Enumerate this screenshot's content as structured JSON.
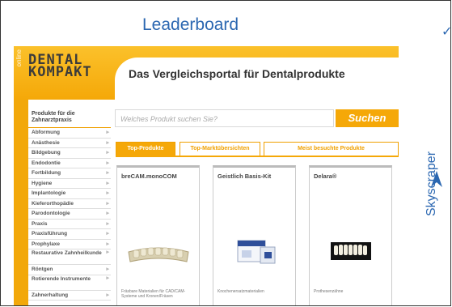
{
  "labels": {
    "leaderboard": "Leaderboard",
    "skyscraper": "Skyscraper"
  },
  "site": {
    "online_label": "online",
    "logo": {
      "line1": "DENTAL",
      "line2": "KOMPAKT"
    },
    "tagline": "Das Vergleichsportal für Dentalprodukte",
    "sidebar": {
      "heading_line1": "Produkte für die",
      "heading_line2": "Zahnarztpraxis",
      "items": [
        "Abformung",
        "Anästhesie",
        "Bildgebung",
        "Endodontie",
        "Fortbildung",
        "Hygiene",
        "Implantologie",
        "Kieferorthopädie",
        "Parodontologie",
        "Praxis",
        "Praxisführung",
        "Prophylaxe",
        "Restaurative Zahnheilkunde",
        "Röntgen",
        "Rotierende Instrumente",
        "Zahnerhaltung"
      ]
    },
    "search": {
      "placeholder": "Welches Produkt suchen Sie?",
      "button": "Suchen"
    },
    "tabs": [
      "Top-Produkte",
      "Top-Marktübersichten",
      "Meist besuchte Produkte"
    ],
    "products": [
      {
        "title": "breCAM.monoCOM",
        "desc": "Fräsbare Materialien für CAD/CAM-Systeme und Kronen/Fräsen"
      },
      {
        "title": "Geistlich Basis-Kit",
        "desc": "Knochenersatzmaterialien"
      },
      {
        "title": "Delara®",
        "desc": "Prothesenzähne"
      }
    ]
  },
  "colors": {
    "accent": "#f5a808",
    "label_blue": "#2b67b1"
  }
}
